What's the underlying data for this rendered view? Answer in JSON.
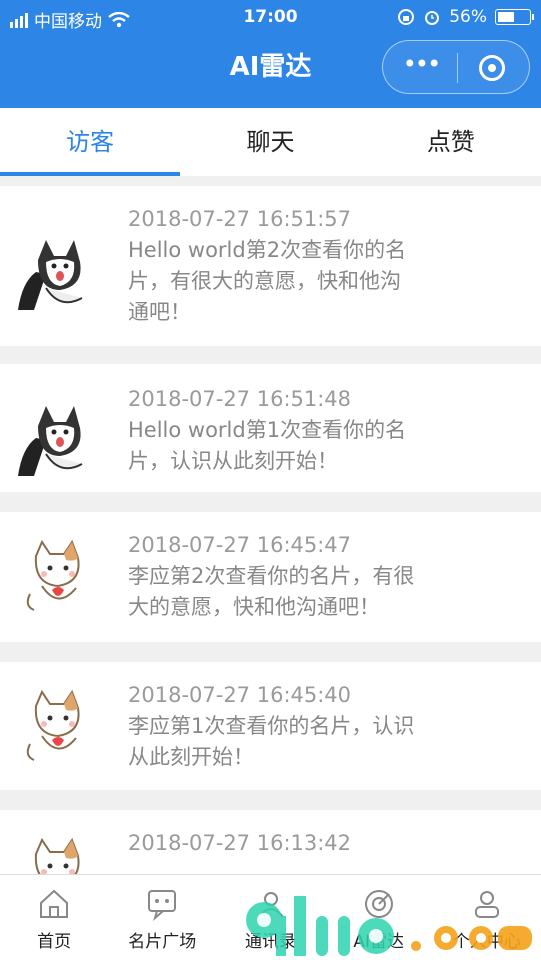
{
  "status_bar": {
    "carrier": "中国移动",
    "time": "17:00",
    "battery_text": "56%",
    "battery_level": 0.56
  },
  "nav": {
    "title": "AI雷达"
  },
  "tabs": [
    {
      "label": "访客",
      "active": true
    },
    {
      "label": "聊天",
      "active": false
    },
    {
      "label": "点赞",
      "active": false
    }
  ],
  "visits": [
    {
      "avatar": "husky-avatar",
      "time": "2018-07-27 16:51:57",
      "message": [
        "Hello world第2次查看你的名",
        "片，有很大的意愿，快和他沟",
        "通吧！"
      ]
    },
    {
      "avatar": "husky-avatar",
      "time": "2018-07-27 16:51:48",
      "message": [
        "Hello world第1次查看你的名",
        "片，认识从此刻开始！"
      ]
    },
    {
      "avatar": "cat-avatar",
      "time": "2018-07-27 16:45:47",
      "message": [
        "李应第2次查看你的名片，有很",
        "大的意愿，快和他沟通吧！"
      ]
    },
    {
      "avatar": "cat-avatar",
      "time": "2018-07-27 16:45:40",
      "message": [
        "李应第1次查看你的名片，认识",
        "从此刻开始！"
      ]
    },
    {
      "avatar": "cat-avatar",
      "time": "2018-07-27 16:13:42",
      "message": []
    }
  ],
  "bottom_tabs": [
    {
      "label": "首页",
      "icon": "home-icon"
    },
    {
      "label": "名片广场",
      "icon": "card-square-icon"
    },
    {
      "label": "通讯录",
      "icon": "contacts-icon"
    },
    {
      "label": "AI雷达",
      "icon": "radar-icon"
    },
    {
      "label": "个人中心",
      "icon": "profile-icon"
    }
  ],
  "colors": {
    "brand": "#2d85e6",
    "text_muted": "#888888"
  }
}
